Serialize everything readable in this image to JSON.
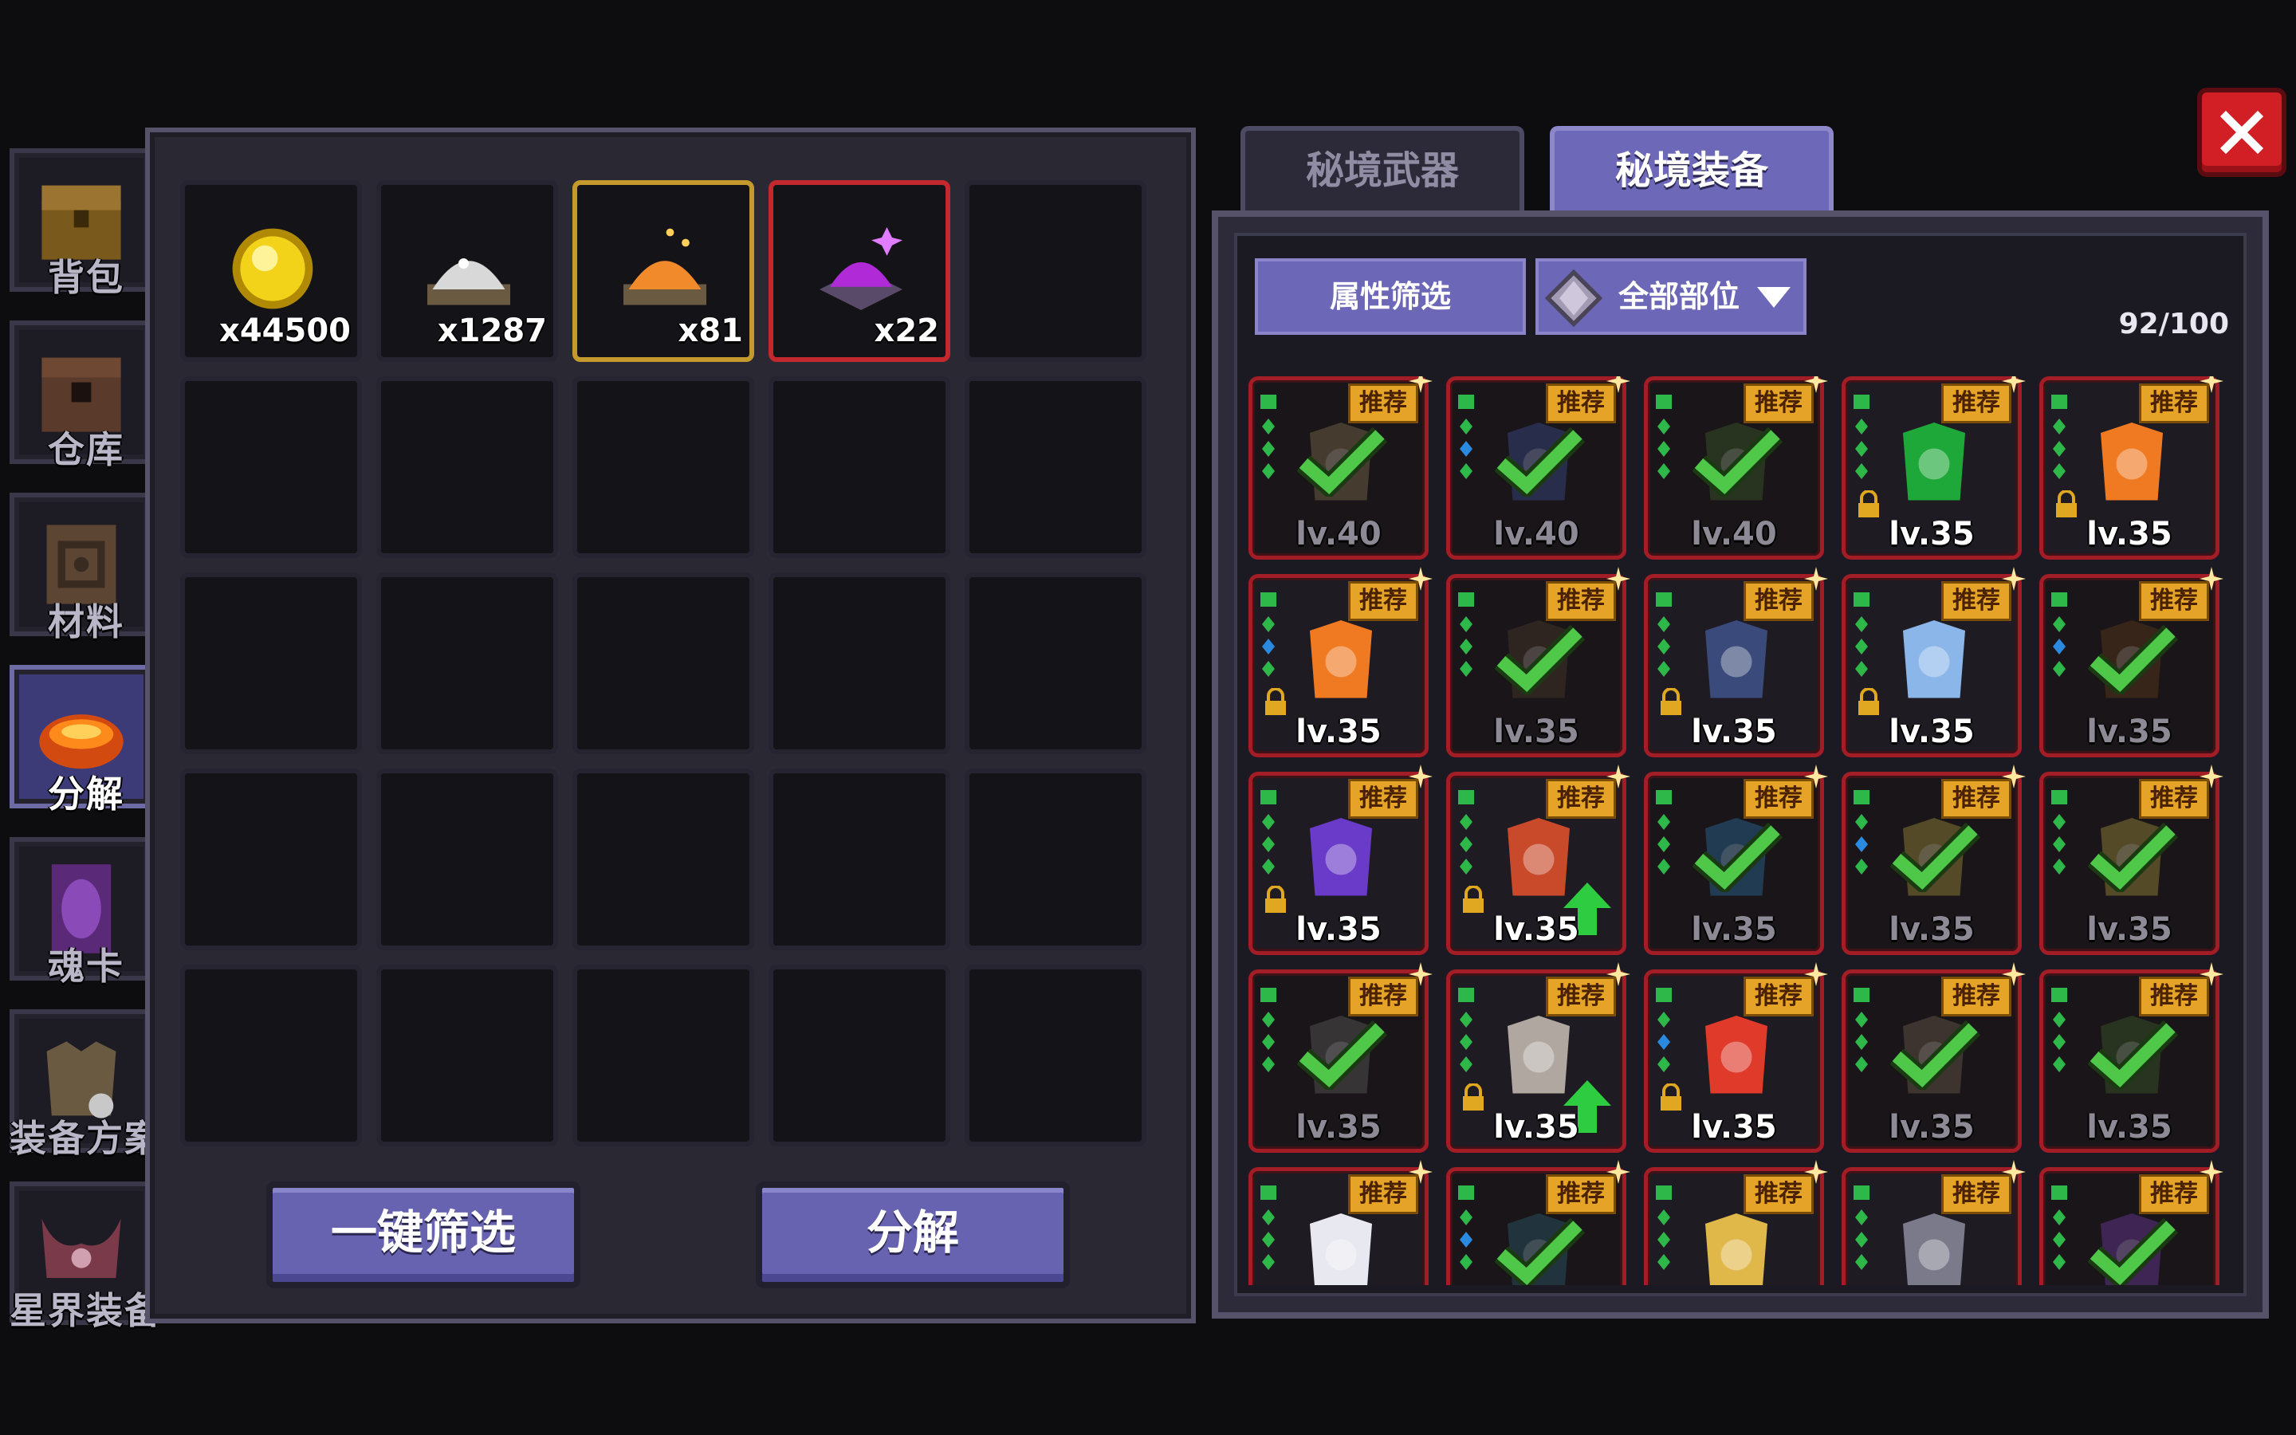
{
  "nav": {
    "items": [
      {
        "label": "背包",
        "icon": "chest-icon"
      },
      {
        "label": "仓库",
        "icon": "storage-chest-icon"
      },
      {
        "label": "材料",
        "icon": "material-book-icon"
      },
      {
        "label": "分解",
        "icon": "furnace-icon"
      },
      {
        "label": "魂卡",
        "icon": "soul-card-icon"
      },
      {
        "label": "装备方案",
        "icon": "armor-set-icon"
      },
      {
        "label": "星界装备",
        "icon": "astral-gear-icon"
      }
    ],
    "active_index": 3
  },
  "materials": [
    {
      "icon": "gold-coin-icon",
      "count": "x44500"
    },
    {
      "icon": "silver-dust-icon",
      "count": "x1287"
    },
    {
      "icon": "orange-dust-icon",
      "count": "x81"
    },
    {
      "icon": "purple-dust-icon",
      "count": "x22"
    }
  ],
  "actions": {
    "quick_filter_label": "一键筛选",
    "decompose_label": "分解"
  },
  "tabs": [
    {
      "label": "秘境武器",
      "active": false
    },
    {
      "label": "秘境装备",
      "active": true
    }
  ],
  "filters": {
    "attribute_filter_label": "属性筛选",
    "slot_dropdown_label": "全部部位"
  },
  "capacity": "92/100",
  "recommend_label": "推荐",
  "equipment": [
    {
      "level": "lv.40",
      "checked": true,
      "locked": false,
      "upgrade": false,
      "icon": "scroll-armor-icon"
    },
    {
      "level": "lv.40",
      "checked": true,
      "locked": false,
      "upgrade": false,
      "icon": "blue-helmet-icon"
    },
    {
      "level": "lv.40",
      "checked": true,
      "locked": false,
      "upgrade": false,
      "icon": "green-armor-icon"
    },
    {
      "level": "lv.35",
      "checked": false,
      "locked": true,
      "upgrade": false,
      "icon": "emerald-necklace-icon"
    },
    {
      "level": "lv.35",
      "checked": false,
      "locked": true,
      "upgrade": false,
      "icon": "flame-necklace-icon"
    },
    {
      "level": "lv.35",
      "checked": false,
      "locked": true,
      "upgrade": false,
      "icon": "flame-necklace-icon"
    },
    {
      "level": "lv.35",
      "checked": true,
      "locked": false,
      "upgrade": false,
      "icon": "dark-necklace-icon"
    },
    {
      "level": "lv.35",
      "checked": false,
      "locked": true,
      "upgrade": false,
      "icon": "dark-armor-icon"
    },
    {
      "level": "lv.35",
      "checked": false,
      "locked": true,
      "upgrade": false,
      "icon": "ice-armor-icon"
    },
    {
      "level": "lv.35",
      "checked": true,
      "locked": false,
      "upgrade": false,
      "icon": "brown-boots-icon"
    },
    {
      "level": "lv.35",
      "checked": false,
      "locked": true,
      "upgrade": false,
      "icon": "purple-gauntlet-icon"
    },
    {
      "level": "lv.35",
      "checked": false,
      "locked": true,
      "upgrade": true,
      "icon": "orb-amulet-icon"
    },
    {
      "level": "lv.35",
      "checked": true,
      "locked": false,
      "upgrade": false,
      "icon": "blue-ring-icon"
    },
    {
      "level": "lv.35",
      "checked": true,
      "locked": false,
      "upgrade": false,
      "icon": "gold-ring-icon"
    },
    {
      "level": "lv.35",
      "checked": true,
      "locked": false,
      "upgrade": false,
      "icon": "gold-ring-icon"
    },
    {
      "level": "lv.35",
      "checked": true,
      "locked": false,
      "upgrade": false,
      "icon": "gray-gauntlet-icon"
    },
    {
      "level": "lv.35",
      "checked": false,
      "locked": true,
      "upgrade": true,
      "icon": "bone-ring-icon"
    },
    {
      "level": "lv.35",
      "checked": false,
      "locked": true,
      "upgrade": false,
      "icon": "red-boots-icon"
    },
    {
      "level": "lv.35",
      "checked": true,
      "locked": false,
      "upgrade": false,
      "icon": "iron-boots-icon"
    },
    {
      "level": "lv.35",
      "checked": true,
      "locked": false,
      "upgrade": false,
      "icon": "green-helmet-icon"
    },
    {
      "level": "",
      "checked": false,
      "locked": false,
      "upgrade": false,
      "icon": "silver-crown-icon"
    },
    {
      "level": "",
      "checked": true,
      "locked": false,
      "upgrade": false,
      "icon": "teal-hat-icon"
    },
    {
      "level": "",
      "checked": false,
      "locked": false,
      "upgrade": false,
      "icon": "golden-armor-icon"
    },
    {
      "level": "",
      "checked": false,
      "locked": false,
      "upgrade": false,
      "icon": "gray-helmet-icon"
    },
    {
      "level": "",
      "checked": true,
      "locked": false,
      "upgrade": false,
      "icon": "purple-hat-icon"
    }
  ],
  "colors": {
    "accent": "#6c67b6",
    "card_border": "#a21d25",
    "recommend_badge": "#e5a428",
    "check": "#4fc84a",
    "close_button": "#d21e25"
  }
}
